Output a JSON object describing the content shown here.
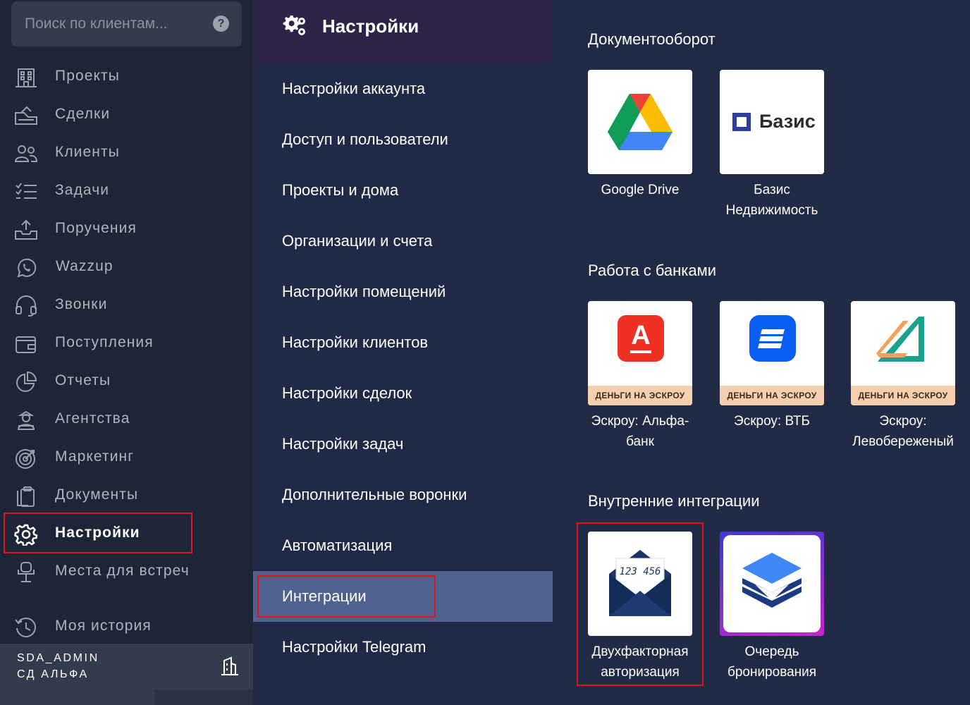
{
  "search": {
    "placeholder": "Поиск по клиентам..."
  },
  "sidebar": {
    "items": [
      {
        "label": "Проекты",
        "icon": "building-icon"
      },
      {
        "label": "Сделки",
        "icon": "deals-icon"
      },
      {
        "label": "Клиенты",
        "icon": "users-icon"
      },
      {
        "label": "Задачи",
        "icon": "tasks-icon"
      },
      {
        "label": "Поручения",
        "icon": "upload-tray-icon"
      },
      {
        "label": "Wazzup",
        "icon": "whatsapp-icon"
      },
      {
        "label": "Звонки",
        "icon": "headset-icon"
      },
      {
        "label": "Поступления",
        "icon": "wallet-icon"
      },
      {
        "label": "Отчеты",
        "icon": "pie-chart-icon"
      },
      {
        "label": "Агентства",
        "icon": "agent-icon"
      },
      {
        "label": "Маркетинг",
        "icon": "target-icon"
      },
      {
        "label": "Документы",
        "icon": "documents-icon"
      },
      {
        "label": "Настройки",
        "icon": "gear-icon",
        "active": true
      },
      {
        "label": "Места для встреч",
        "icon": "meeting-place-icon"
      },
      {
        "label": "Моя история",
        "icon": "history-icon"
      }
    ]
  },
  "user": {
    "name": "SDA_ADMIN",
    "org": "СД АЛЬФА"
  },
  "settings": {
    "title": "Настройки",
    "items": [
      {
        "label": "Настройки аккаунта"
      },
      {
        "label": "Доступ и пользователи"
      },
      {
        "label": "Проекты и дома"
      },
      {
        "label": "Организации и счета"
      },
      {
        "label": "Настройки помещений"
      },
      {
        "label": "Настройки клиентов"
      },
      {
        "label": "Настройки сделок"
      },
      {
        "label": "Настройки задач"
      },
      {
        "label": "Дополнительные воронки"
      },
      {
        "label": "Автоматизация"
      },
      {
        "label": "Интеграции",
        "active": true
      },
      {
        "label": "Настройки Telegram"
      }
    ]
  },
  "integrations": {
    "documents": {
      "title": "Документооборот",
      "cards": [
        {
          "name": "Google Drive",
          "icon": "google-drive-icon"
        },
        {
          "name": "Базис Недвижимость",
          "icon": "basis-logo",
          "logo_text": "Базис"
        }
      ]
    },
    "banks": {
      "title": "Работа с банками",
      "cards": [
        {
          "name": "Эскроу: Альфа-банк",
          "band": "ДЕНЬГИ НА ЭСКРОУ",
          "icon": "alfa-bank-icon",
          "logo_text": "А"
        },
        {
          "name": "Эскроу: ВТБ",
          "band": "ДЕНЬГИ НА ЭСКРОУ",
          "icon": "vtb-icon"
        },
        {
          "name": "Эскроу: Левобереженый",
          "band": "ДЕНЬГИ НА ЭСКРОУ",
          "icon": "levoberezhny-icon"
        }
      ]
    },
    "internal": {
      "title": "Внутренние интеграции",
      "cards": [
        {
          "name": "Двухфакторная авторизация",
          "icon": "envelope-code-icon",
          "code": "123 456"
        },
        {
          "name": "Очередь бронирования",
          "icon": "layers-icon"
        }
      ]
    }
  },
  "colors": {
    "highlight": "#e0141b",
    "active_menu": "#506290",
    "header": "#2d2448",
    "sidebar": "#1e2537"
  }
}
